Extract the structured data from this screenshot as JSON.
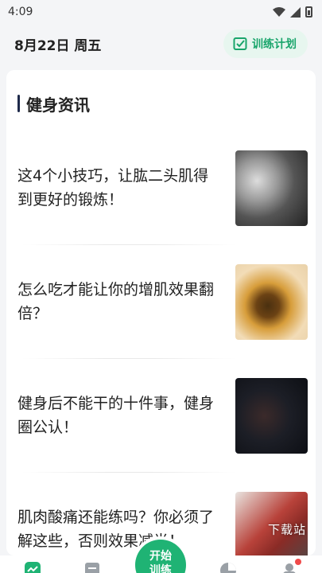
{
  "status": {
    "time": "4:09"
  },
  "header": {
    "date": "8月22日 周五",
    "plan_label": "训练计划"
  },
  "section": {
    "title": "健身资讯"
  },
  "articles": [
    {
      "title": "这4个小技巧，让肱二头肌得到更好的锻炼！",
      "thumbnail": "arm-workout-photo"
    },
    {
      "title": "怎么吃才能让你的增肌效果翻倍？",
      "thumbnail": "food-bowl-photo"
    },
    {
      "title": "健身后不能干的十件事，健身圈公认！",
      "thumbnail": "gym-workout-photo"
    },
    {
      "title": "肌肉酸痛还能练吗？你必须了解这些，否则效果减半！",
      "thumbnail": "weightlifter-photo",
      "watermark": "下载站"
    }
  ],
  "tabbar": {
    "start_label_line1": "开始",
    "start_label_line2": "训练"
  },
  "colors": {
    "accent": "#1fb374",
    "accent_bg": "#e7f6ef",
    "title_bar": "#1e2a4a",
    "badge": "#f04a4a"
  }
}
